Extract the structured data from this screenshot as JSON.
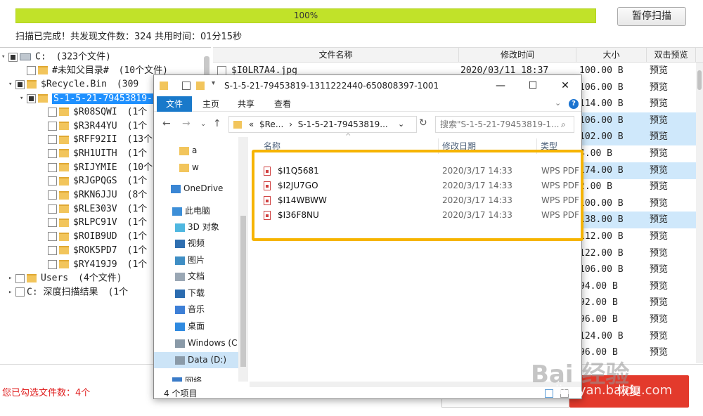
{
  "app": {
    "progress_text": "100%",
    "progress_value": 1.0,
    "pause_button": "暂停扫描",
    "scan_status": "扫描已完成！共发现文件数：324  共用时间：01分15秒",
    "selected_count": "您已勾选文件数：4个",
    "recover_button": "恢复",
    "colors": {
      "progress": "#c1e229",
      "recover": "#e33a2c",
      "selected": "#1e90ff",
      "highlight": "#f6b400"
    }
  },
  "tree": [
    {
      "label": "C:",
      "count": "(323个文件)"
    },
    {
      "label": "#未知父目录#",
      "count": "(10个文件)"
    },
    {
      "label": "$Recycle.Bin",
      "count": "(309"
    },
    {
      "label": "S-1-5-21-79453819-",
      "count": ""
    },
    {
      "label": "$R08SQWI",
      "count": "(1个"
    },
    {
      "label": "$R3R44YU",
      "count": "(1个"
    },
    {
      "label": "$RFF92II",
      "count": "(13个"
    },
    {
      "label": "$RH1UITH",
      "count": "(1个"
    },
    {
      "label": "$RIJYMIE",
      "count": "(10个"
    },
    {
      "label": "$RJGPQGS",
      "count": "(1个"
    },
    {
      "label": "$RKN6JJU",
      "count": "(8个"
    },
    {
      "label": "$RLE303V",
      "count": "(1个"
    },
    {
      "label": "$RLPC91V",
      "count": "(1个"
    },
    {
      "label": "$ROIB9UD",
      "count": "(1个"
    },
    {
      "label": "$ROK5PD7",
      "count": "(1个"
    },
    {
      "label": "$RY419J9",
      "count": "(1个"
    },
    {
      "label": "Users",
      "count": "(4个文件)"
    },
    {
      "label": "C: 深度扫描结果",
      "count": "(1个"
    }
  ],
  "list": {
    "headers": [
      "文件名称",
      "修改时间",
      "大小",
      "双击预览"
    ],
    "first_row": {
      "name": "$I0LR7A4.jpg",
      "date": "2020/03/11 18:37"
    },
    "sizes": [
      "100.00 B",
      "106.00 B",
      "114.00 B",
      "106.00 B",
      "102.00 B",
      "4.00 B",
      "174.00 B",
      "2.00 B",
      "100.00 B",
      "138.00 B",
      "112.00 B",
      "122.00 B",
      "106.00 B",
      "94.00 B",
      "92.00 B",
      "96.00 B",
      "124.00 B",
      "96.00 B"
    ],
    "preview": "预览",
    "highlighted_rows": [
      3,
      4,
      6,
      9
    ]
  },
  "explorer": {
    "title": "S-1-5-21-79453819-1311222440-650808397-1001",
    "tabs": [
      "文件",
      "主页",
      "共享",
      "查看"
    ],
    "address_parts": [
      "«",
      "$Re...",
      "›",
      "S-1-5-21-79453819..."
    ],
    "search_placeholder": "搜索\"S-1-5-21-79453819-1...",
    "nav_items": [
      "a",
      "w",
      "OneDrive",
      "此电脑",
      "3D 对象",
      "视频",
      "图片",
      "文档",
      "下载",
      "音乐",
      "桌面",
      "Windows (C",
      "Data (D:)",
      "网络"
    ],
    "columns": [
      "名称",
      "修改日期",
      "类型"
    ],
    "files": [
      {
        "name": "$I1Q5681",
        "date": "2020/3/17 14:33",
        "type": "WPS PDF"
      },
      {
        "name": "$I2JU7GO",
        "date": "2020/3/17 14:33",
        "type": "WPS PDF"
      },
      {
        "name": "$I14WBWW",
        "date": "2020/3/17 14:33",
        "type": "WPS PDF"
      },
      {
        "name": "$I36F8NU",
        "date": "2020/3/17 14:33",
        "type": "WPS PDF"
      }
    ],
    "status": "4 个项目"
  },
  "watermark": {
    "main": "Bai 经验",
    "sub": "jingyan.baidu.com"
  }
}
